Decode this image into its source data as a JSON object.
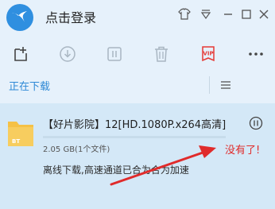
{
  "header": {
    "login_text": "点击登录"
  },
  "tabs": {
    "downloading_label": "正在下载"
  },
  "task": {
    "title": "【好片影院】12[HD.1080P.x264高清]",
    "file_type": "BT",
    "size_text": "2.05 GB(1个文件)",
    "status_text": "离线下载,高速通道已合为合为加速",
    "progress": 0.0
  },
  "annotation": {
    "text": "没有了!"
  },
  "colors": {
    "background": "#e6f1fb",
    "accent": "#2e89d6",
    "task_bg": "#d4e8f7",
    "annotation": "#e02b2b",
    "folder": "#f5c146"
  },
  "icons": {
    "logo": "app-logo-icon",
    "new_task": "new-task-icon",
    "start": "download-start-icon",
    "pause": "pause-icon",
    "delete": "trash-icon",
    "vip": "vip-icon",
    "more": "more-icon"
  }
}
